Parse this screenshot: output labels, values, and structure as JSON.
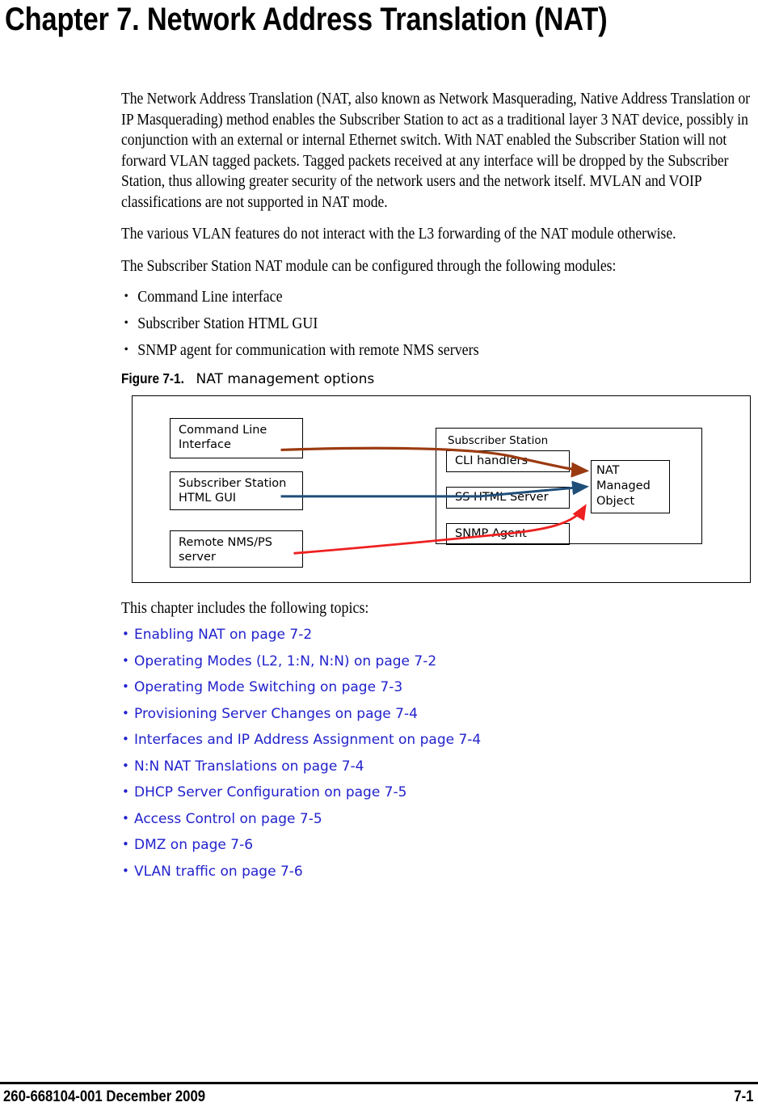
{
  "chapter": {
    "title": "Chapter 7. Network Address Translation (NAT)"
  },
  "paragraphs": {
    "intro": "The Network Address Translation (NAT, also known as Network Masquerading, Native Address Translation or IP Masquerading) method enables the Subscriber Station to act as a traditional layer 3 NAT device, possibly in conjunction with an external or internal Ethernet switch. With NAT enabled the Subscriber Station will not forward VLAN tagged packets. Tagged packets received at any interface will be dropped by the Subscriber Station, thus allowing greater security of the network users and the network itself. MVLAN and VOIP classifications are not supported in NAT mode.",
    "vlan_note": "The various VLAN features do not interact with the L3 forwarding of the NAT module otherwise.",
    "modules_intro": "The Subscriber Station NAT module can be configured through the following modules:",
    "topics_intro": "This chapter includes the following topics:"
  },
  "module_bullets": [
    "Command Line interface",
    "Subscriber Station HTML GUI",
    "SNMP agent for communication with remote NMS servers"
  ],
  "figure": {
    "label": "Figure 7-1.",
    "caption": "NAT management options",
    "boxes": {
      "command_line_interface": "Command Line\nInterface",
      "subscriber_station_html_gui": "Subscriber Station\nHTML GUI",
      "remote_nms_ps_server": "Remote NMS/PS\nserver",
      "subscriber_station": "Subscriber Station",
      "cli_handlers": "CLI handlers",
      "ss_html_server": "SS HTML Server",
      "snmp_agent": "SNMP Agent",
      "nat_managed_object": "NAT\nManaged\nObject"
    },
    "connector_colors": {
      "cli_path": "#9B3A11",
      "html_gui_path": "#1F4E79",
      "nms_path": "#EE2020"
    }
  },
  "topic_links": [
    "Enabling NAT on page 7-2",
    "Operating Modes (L2, 1:N, N:N) on page 7-2",
    "Operating Mode Switching on page 7-3",
    "Provisioning Server Changes on page 7-4",
    "Interfaces and IP Address Assignment on page 7-4",
    "N:N NAT Translations on page 7-4",
    "DHCP Server Configuration on page 7-5",
    "Access Control on page 7-5",
    "DMZ on page 7-6",
    "VLAN traffic on page 7-6"
  ],
  "link_color": "#2222CC",
  "footer": {
    "left": "260-668104-001 December 2009",
    "right": "7-1"
  }
}
